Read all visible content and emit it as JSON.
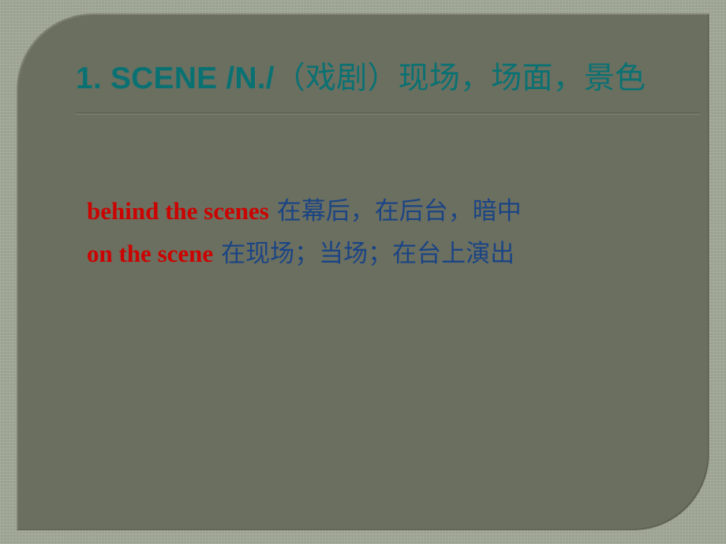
{
  "slide": {
    "background_outer_color": "#9ba291",
    "background_panel_color": "#6b6f5f",
    "title": {
      "latin_part": "1. SCENE /N./",
      "han_part": "（戏剧）现场，场面，景色",
      "full_text": "1. SCENE /N./（戏剧）现场，场面，景色",
      "color": "#0a7173"
    },
    "divider": {
      "dark_color": "#4b5040",
      "light_color": "#8d937f"
    },
    "entries": [
      {
        "term": "behind the scenes",
        "gloss": "在幕后，在后台，暗中",
        "term_color": "#cc0200",
        "gloss_color": "#1b4485"
      },
      {
        "term": "on the scene",
        "gloss": "在现场；当场；在台上演出",
        "term_color": "#cc0200",
        "gloss_color": "#1b4485"
      }
    ]
  }
}
